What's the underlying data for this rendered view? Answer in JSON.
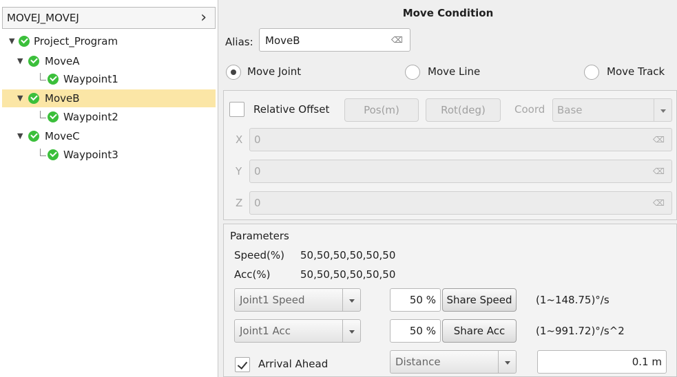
{
  "tree": {
    "header": "MOVEJ_MOVEJ",
    "nodes": [
      "Project_Program",
      "MoveA",
      "Waypoint1",
      "MoveB",
      "Waypoint2",
      "MoveC",
      "Waypoint3"
    ],
    "selected": "MoveB"
  },
  "panel": {
    "title": "Move Condition",
    "alias_label": "Alias:",
    "alias_value": "MoveB",
    "move_options": [
      "Move Joint",
      "Move Line",
      "Move Track"
    ],
    "move_selected": "Move Joint"
  },
  "offset": {
    "relative_offset_label": "Relative Offset",
    "pos_button": "Pos(m)",
    "rot_button": "Rot(deg)",
    "coord_label": "Coord",
    "coord_value": "Base",
    "x_label": "X",
    "x_value": "0",
    "y_label": "Y",
    "y_value": "0",
    "z_label": "Z",
    "z_value": "0"
  },
  "params": {
    "title": "Parameters",
    "speed_label": "Speed(%)",
    "speed_value": "50,50,50,50,50,50",
    "acc_label": "Acc(%)",
    "acc_value": "50,50,50,50,50,50",
    "speed_combo": "Joint1 Speed",
    "speed_percent": "50 %",
    "share_speed_button": "Share Speed",
    "speed_range": "(1~148.75)°/s",
    "acc_combo": "Joint1 Acc",
    "acc_percent": "50 %",
    "share_acc_button": "Share Acc",
    "acc_range": "(1~991.72)°/s^2",
    "arrival_ahead_label": "Arrival Ahead",
    "arrival_ahead_checked": true,
    "arrival_mode": "Distance",
    "arrival_value": "0.1 m"
  },
  "colors": {
    "selected_row": "#fbe6a6",
    "status_check": "#3bbf3b"
  }
}
